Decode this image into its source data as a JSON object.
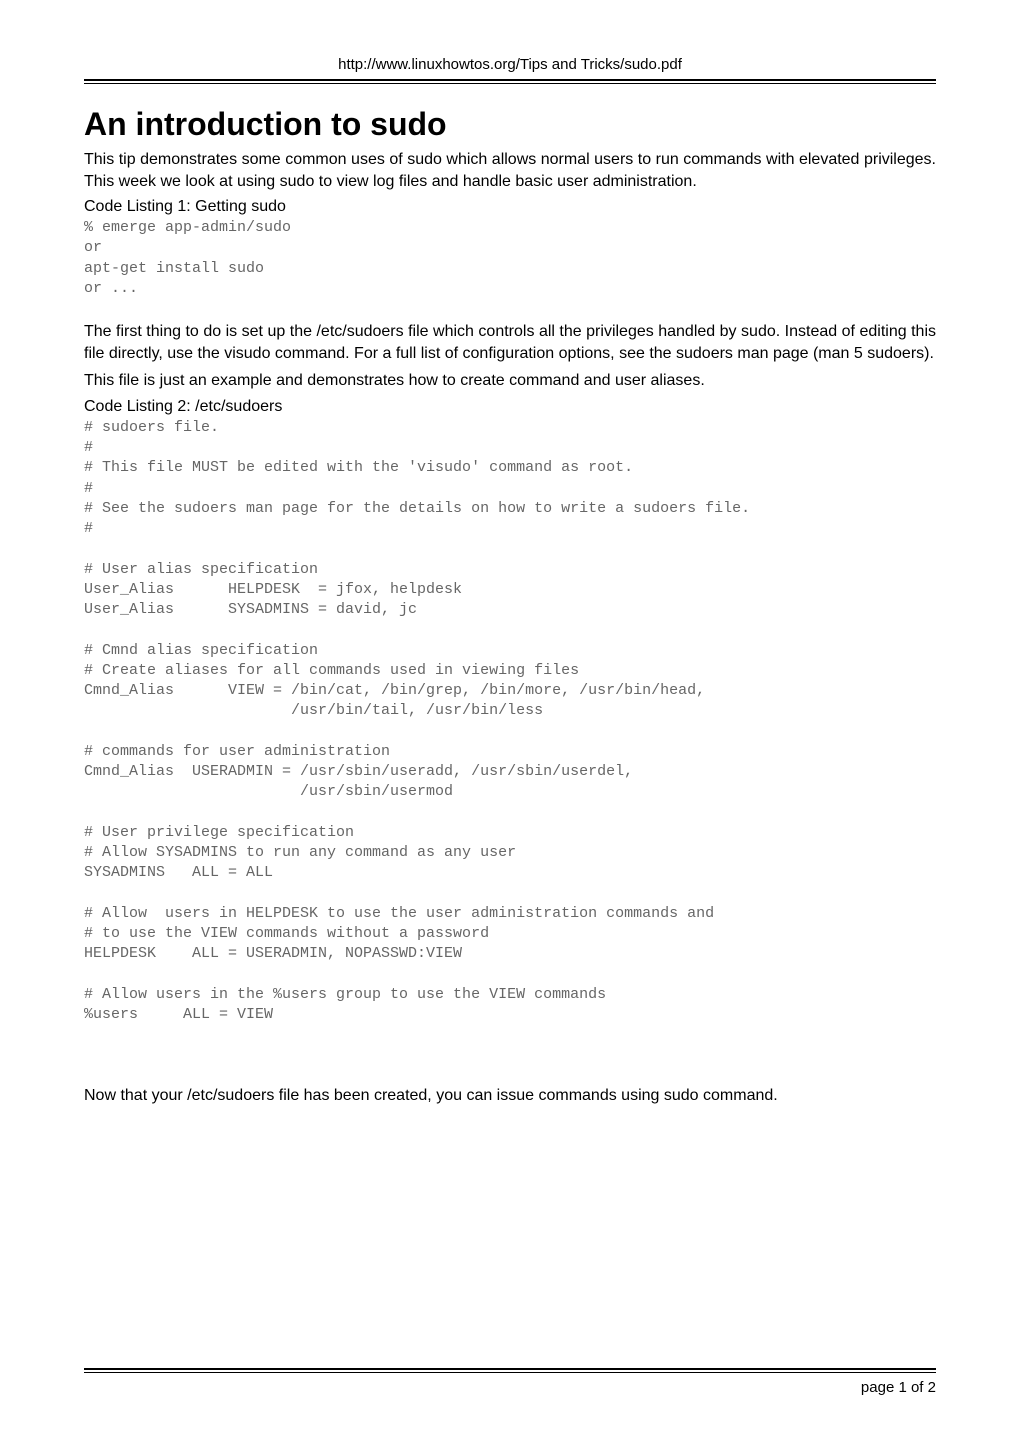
{
  "header": {
    "url": "http://www.linuxhowtos.org/Tips and Tricks/sudo.pdf"
  },
  "title": "An introduction to sudo",
  "intro": "This tip demonstrates some common uses of sudo which allows normal users to run commands with elevated privileges. This week we look at using sudo to view log files and handle basic user administration.",
  "listing1": {
    "title": "Code Listing 1: Getting sudo",
    "code": "% emerge app-admin/sudo\nor\napt-get install sudo\nor ..."
  },
  "para2": "The first thing to do is set up the /etc/sudoers file which controls all the privileges handled by sudo. Instead of editing this file directly, use the visudo command. For a full list of configuration options, see the sudoers man page (man 5 sudoers).",
  "para3": "This file is just an example and demonstrates how to create command and user aliases.",
  "listing2": {
    "title": "Code Listing 2: /etc/sudoers",
    "code": "# sudoers file.\n#\n# This file MUST be edited with the 'visudo' command as root.\n#\n# See the sudoers man page for the details on how to write a sudoers file.\n#\n\n# User alias specification\nUser_Alias      HELPDESK  = jfox, helpdesk\nUser_Alias      SYSADMINS = david, jc\n\n# Cmnd alias specification\n# Create aliases for all commands used in viewing files\nCmnd_Alias      VIEW = /bin/cat, /bin/grep, /bin/more, /usr/bin/head,\n                       /usr/bin/tail, /usr/bin/less\n\n# commands for user administration\nCmnd_Alias  USERADMIN = /usr/sbin/useradd, /usr/sbin/userdel,\n                        /usr/sbin/usermod\n\n# User privilege specification\n# Allow SYSADMINS to run any command as any user\nSYSADMINS   ALL = ALL\n\n# Allow  users in HELPDESK to use the user administration commands and\n# to use the VIEW commands without a password\nHELPDESK    ALL = USERADMIN, NOPASSWD:VIEW\n\n# Allow users in the %users group to use the VIEW commands\n%users     ALL = VIEW"
  },
  "para4": "Now that your /etc/sudoers file has been created, you can issue commands using sudo command.",
  "footer": {
    "page": "page 1 of 2"
  }
}
